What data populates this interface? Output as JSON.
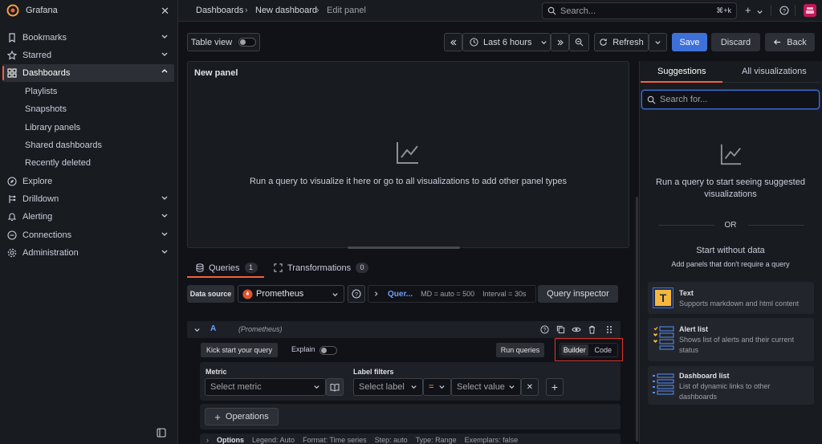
{
  "sidebar": {
    "app_name": "Grafana",
    "items": [
      {
        "label": "Bookmarks",
        "icon": "bookmark-icon"
      },
      {
        "label": "Starred",
        "icon": "star-icon"
      },
      {
        "label": "Dashboards",
        "icon": "dashboards-icon",
        "active": true
      },
      {
        "label": "Explore",
        "icon": "compass-icon"
      },
      {
        "label": "Drilldown",
        "icon": "drilldown-icon"
      },
      {
        "label": "Alerting",
        "icon": "bell-icon"
      },
      {
        "label": "Connections",
        "icon": "connections-icon"
      },
      {
        "label": "Administration",
        "icon": "gear-icon"
      }
    ],
    "sub_items": [
      "Playlists",
      "Snapshots",
      "Library panels",
      "Shared dashboards",
      "Recently deleted"
    ]
  },
  "topbar": {
    "breadcrumb": [
      "Dashboards",
      "New dashboard",
      "Edit panel"
    ],
    "search_placeholder": "Search...",
    "search_shortcut": "⌘+k"
  },
  "toolbar": {
    "table_view": "Table view",
    "time_range": "Last 6 hours",
    "refresh": "Refresh",
    "save": "Save",
    "discard": "Discard",
    "back": "Back"
  },
  "panel": {
    "title": "New panel",
    "empty_message": "Run a query to visualize it here or go to all visualizations to add other panel types"
  },
  "tabs": {
    "queries": {
      "label": "Queries",
      "count": "1"
    },
    "transformations": {
      "label": "Transformations",
      "count": "0"
    }
  },
  "query_editor": {
    "datasource_label": "Data source",
    "datasource": "Prometheus",
    "query_options_name": "Quer...",
    "md": "MD = auto = 500",
    "interval": "Interval = 30s",
    "inspector": "Query inspector",
    "query_letter": "A",
    "query_datasource": "(Prometheus)",
    "kick_start": "Kick start your query",
    "explain": "Explain",
    "run_queries": "Run queries",
    "mode_builder": "Builder",
    "mode_code": "Code",
    "metric_label": "Metric",
    "metric_placeholder": "Select metric",
    "label_filters": "Label filters",
    "select_label": "Select label",
    "operator": "=",
    "select_value": "Select value",
    "operations": "Operations",
    "options": {
      "title": "Options",
      "legend": "Legend: Auto",
      "format": "Format: Time series",
      "step": "Step: auto",
      "type": "Type: Range",
      "exemplars": "Exemplars: false"
    }
  },
  "viz_pane": {
    "tab_suggestions": "Suggestions",
    "tab_all": "All visualizations",
    "search_placeholder": "Search for...",
    "hint_line1": "Run a query to start seeing suggested",
    "hint_line2": "visualizations",
    "or": "OR",
    "start_without": "Start without data",
    "start_without_sub": "Add panels that don't require a query",
    "cards": [
      {
        "title": "Text",
        "desc": "Supports markdown and html content"
      },
      {
        "title": "Alert list",
        "desc": "Shows list of alerts and their current status"
      },
      {
        "title": "Dashboard list",
        "desc": "List of dynamic links to other dashboards"
      }
    ]
  },
  "colors": {
    "accent": "#f55f3e",
    "primary": "#3d71d9",
    "highlight_box": "#e0362b"
  }
}
